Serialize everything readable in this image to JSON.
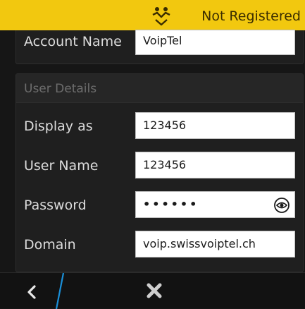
{
  "status": {
    "icon": "network-people-icon",
    "text": "Not Registered",
    "color": "#f2c80f"
  },
  "account": {
    "label": "Account Name",
    "value": "VoipTel"
  },
  "user_details": {
    "title": "User Details",
    "display_as": {
      "label": "Display as",
      "value": "123456"
    },
    "user_name": {
      "label": "User Name",
      "value": "123456"
    },
    "password": {
      "label": "Password",
      "masked": "••••••",
      "icon": "eye-icon"
    },
    "domain": {
      "label": "Domain",
      "value": "voip.swissvoiptel.ch"
    }
  },
  "bottom_bar": {
    "back_icon": "chevron-left-icon",
    "close_icon": "close-icon",
    "accent": "#1a8fd8"
  }
}
